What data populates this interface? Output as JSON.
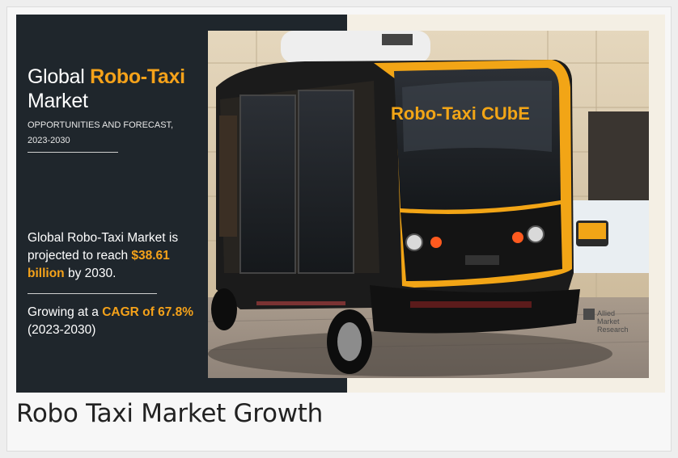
{
  "infographic": {
    "title_prefix": "Global ",
    "title_highlight": "Robo-Taxi",
    "title_suffix": "Market",
    "subtitle_line1": "OPPORTUNITIES AND FORECAST,",
    "subtitle_line2": "2023-2030",
    "stat1_pre": "Global Robo-Taxi Market is projected to reach ",
    "stat1_value": "$38.61 billion",
    "stat1_post": " by 2030.",
    "stat2_pre": "Growing at a ",
    "stat2_value": "CAGR of 67.8%",
    "stat2_post": "(2023-2030)",
    "vehicle_label": "Robo-Taxi CUbE",
    "logo_line1": "Allied",
    "logo_line2": "Market",
    "logo_line3": "Research"
  },
  "caption": "Robo Taxi Market Growth",
  "colors": {
    "accent": "#f5a21a",
    "panel_bg": "#1f262c",
    "vehicle_body": "#1b1b1b",
    "vehicle_trim": "#f2a516"
  },
  "icons": {
    "logo": "allied-market-research-logo"
  }
}
